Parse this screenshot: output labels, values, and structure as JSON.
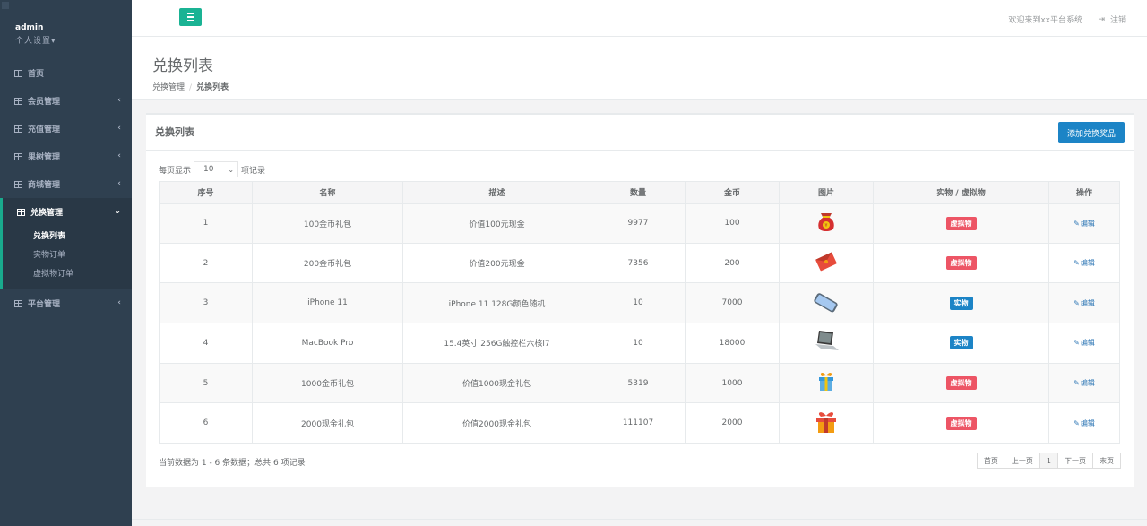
{
  "sidebar": {
    "username": "admin",
    "settings_label": "个人设置",
    "items": [
      {
        "label": "首页",
        "has_arrow": false
      },
      {
        "label": "会员管理",
        "has_arrow": true
      },
      {
        "label": "充值管理",
        "has_arrow": true
      },
      {
        "label": "果树管理",
        "has_arrow": true
      },
      {
        "label": "商城管理",
        "has_arrow": true
      },
      {
        "label": "兑换管理",
        "has_arrow": true,
        "active": true
      },
      {
        "label": "平台管理",
        "has_arrow": true
      }
    ],
    "submenu": [
      {
        "label": "兑换列表",
        "current": true
      },
      {
        "label": "实物订单"
      },
      {
        "label": "虚拟物订单"
      }
    ]
  },
  "topbar": {
    "welcome": "欢迎来到xx平台系统",
    "logout": "注销"
  },
  "heading": {
    "title": "兑换列表",
    "breadcrumb_parent": "兑换管理",
    "breadcrumb_current": "兑换列表"
  },
  "box": {
    "title": "兑换列表",
    "add_button": "添加兑换奖品",
    "length_prefix": "每页显示",
    "length_value": "10",
    "length_suffix": "项记录"
  },
  "table": {
    "headers": [
      "序号",
      "名称",
      "描述",
      "数量",
      "金币",
      "图片",
      "实物 / 虚拟物",
      "操作"
    ],
    "rows": [
      {
        "id": "1",
        "name": "100金币礼包",
        "desc": "价值100元现金",
        "qty": "9977",
        "coins": "100",
        "icon": "money-bag-icon",
        "type": "虚拟物",
        "action": "编辑"
      },
      {
        "id": "2",
        "name": "200金币礼包",
        "desc": "价值200元现金",
        "qty": "7356",
        "coins": "200",
        "icon": "red-envelope-icon",
        "type": "虚拟物",
        "action": "编辑"
      },
      {
        "id": "3",
        "name": "iPhone 11",
        "desc": "iPhone 11 128G颜色随机",
        "qty": "10",
        "coins": "7000",
        "icon": "phone-icon",
        "type": "实物",
        "action": "编辑"
      },
      {
        "id": "4",
        "name": "MacBook Pro",
        "desc": "15.4英寸 256G触控栏六核i7",
        "qty": "10",
        "coins": "18000",
        "icon": "laptop-icon",
        "type": "实物",
        "action": "编辑"
      },
      {
        "id": "5",
        "name": "1000金币礼包",
        "desc": "价值1000现金礼包",
        "qty": "5319",
        "coins": "1000",
        "icon": "gift-box-blue-icon",
        "type": "虚拟物",
        "action": "编辑"
      },
      {
        "id": "6",
        "name": "2000现金礼包",
        "desc": "价值2000现金礼包",
        "qty": "111107",
        "coins": "2000",
        "icon": "gift-box-red-icon",
        "type": "虚拟物",
        "action": "编辑"
      }
    ]
  },
  "footer": {
    "info": "当前数据为 1 - 6 条数据；总共 6 项记录",
    "pages": [
      "首页",
      "上一页",
      "1",
      "下一页",
      "末页"
    ]
  },
  "colors": {
    "sidebar": "#2f4050",
    "accent": "#1ab394",
    "primary": "#1c84c6",
    "virtual": "#ed5565",
    "physical": "#1c84c6"
  }
}
